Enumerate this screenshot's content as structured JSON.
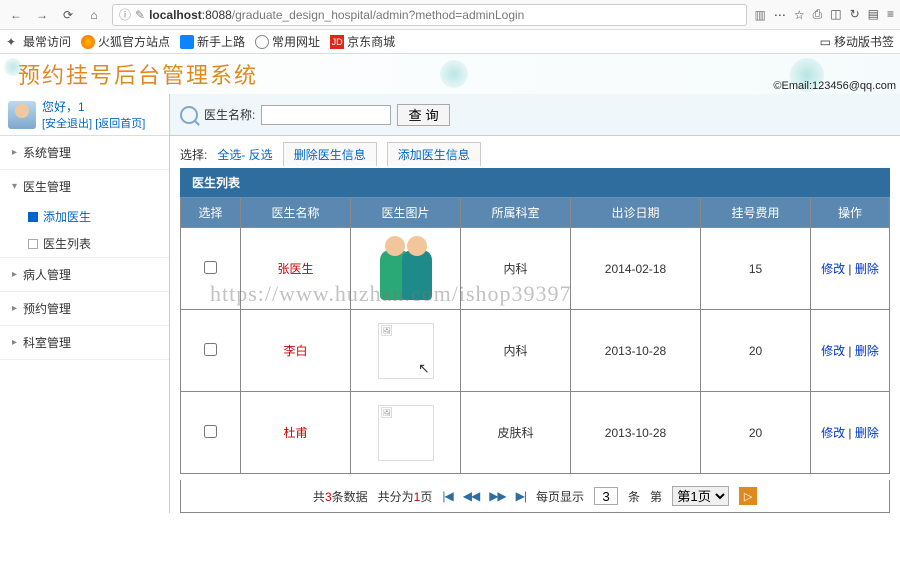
{
  "browser": {
    "url_host": "localhost",
    "url_port": ":8088",
    "url_path": "/graduate_design_hospital/admin?method=adminLogin",
    "bookmarks": [
      "最常访问",
      "火狐官方站点",
      "新手上路",
      "常用网址",
      "京东商城"
    ],
    "mobile_bookmarks": "移动版书签"
  },
  "header": {
    "title": "预约挂号后台管理系统",
    "email": "©Email:123456@qq.com"
  },
  "user": {
    "hello": "您好，",
    "name": "1",
    "logout": "[安全退出]",
    "home": "[返回首页]"
  },
  "sidebar": {
    "items": [
      {
        "label": "系统管理"
      },
      {
        "label": "医生管理",
        "open": true,
        "children": [
          {
            "label": "添加医生",
            "active": true
          },
          {
            "label": "医生列表"
          }
        ]
      },
      {
        "label": "病人管理"
      },
      {
        "label": "预约管理"
      },
      {
        "label": "科室管理"
      }
    ]
  },
  "search": {
    "label": "医生名称:",
    "button": "查 询"
  },
  "actions": {
    "select_label": "选择:",
    "select_all": "全选- 反选",
    "delete_tab": "删除医生信息",
    "add_tab": "添加医生信息"
  },
  "table": {
    "title": "医生列表",
    "headers": [
      "选择",
      "医生名称",
      "医生图片",
      "所属科室",
      "出诊日期",
      "挂号费用",
      "操作"
    ],
    "rows": [
      {
        "name": "张医生",
        "dept": "内科",
        "date": "2014-02-18",
        "fee": "15",
        "img": "figure"
      },
      {
        "name": "李白",
        "dept": "内科",
        "date": "2013-10-28",
        "fee": "20",
        "img": "box"
      },
      {
        "name": "杜甫",
        "dept": "皮肤科",
        "date": "2013-10-28",
        "fee": "20",
        "img": "box"
      }
    ],
    "op_edit": "修改",
    "op_delete": "删除"
  },
  "pager": {
    "total_prefix": "共",
    "total_count": "3",
    "total_suffix": "条数据",
    "pages_prefix": "共分为",
    "pages_count": "1",
    "pages_suffix": "页",
    "per_page_label": "每页显示",
    "per_page_value": "3",
    "per_page_suffix": "条",
    "page_label": "第",
    "page_current": "第1页",
    "go": "▷"
  },
  "watermark": "https://www.huzhan.com/ishop39397"
}
